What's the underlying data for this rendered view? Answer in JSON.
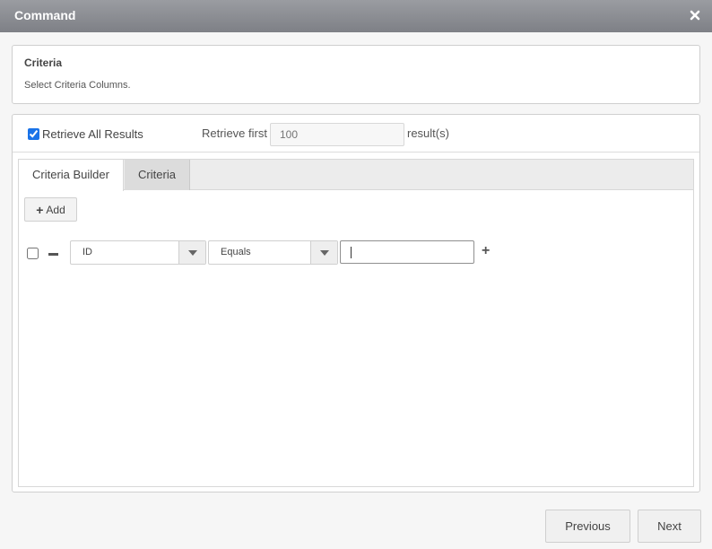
{
  "dialog": {
    "title": "Command",
    "close_icon": "close-icon"
  },
  "info": {
    "heading": "Criteria",
    "description": "Select Criteria Columns."
  },
  "retrieve": {
    "all_label": "Retrieve All Results",
    "all_checked": true,
    "first_label": "Retrieve first",
    "first_placeholder": "100",
    "results_label": "result(s)"
  },
  "tabs": [
    {
      "label": "Criteria Builder",
      "active": true
    },
    {
      "label": "Criteria",
      "active": false
    }
  ],
  "builder": {
    "add_label": "Add",
    "row": {
      "field": "ID",
      "operator": "Equals",
      "value": ""
    }
  },
  "footer": {
    "previous_label": "Previous",
    "next_label": "Next"
  },
  "colors": {
    "titlebar": "#8a8c91",
    "accent": "#1a73e8"
  }
}
